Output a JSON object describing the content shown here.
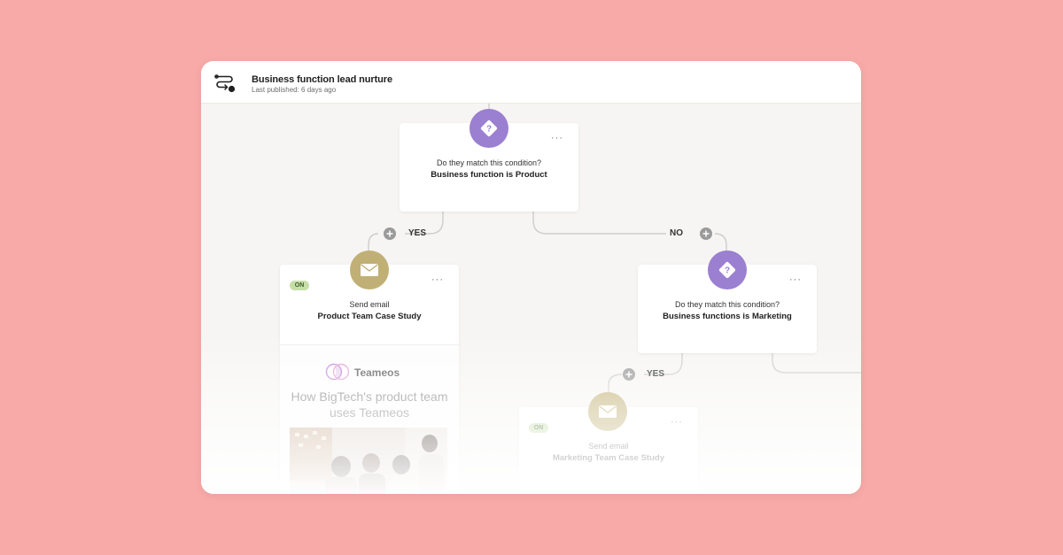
{
  "header": {
    "title": "Business function lead nurture",
    "subtitle": "Last published: 6 days ago",
    "icon": "workflow-icon"
  },
  "nodes": {
    "condition_product": {
      "type": "condition",
      "icon": "question-diamond-icon",
      "prompt": "Do they match this condition?",
      "condition": "Business function is Product",
      "menu": "···"
    },
    "email_product": {
      "type": "email",
      "icon": "envelope-icon",
      "status": "ON",
      "action": "Send email",
      "name": "Product Team Case Study",
      "menu": "···",
      "preview": {
        "brand": "Teameos",
        "heading": "How BigTech's product team uses Teameos"
      }
    },
    "condition_marketing": {
      "type": "condition",
      "icon": "question-diamond-icon",
      "prompt": "Do they match this condition?",
      "condition": "Business functions is Marketing",
      "menu": "···"
    },
    "email_marketing": {
      "type": "email",
      "icon": "envelope-icon",
      "status": "ON",
      "action": "Send email",
      "name": "Marketing Team Case Study",
      "menu": "···"
    }
  },
  "branches": {
    "yes_1": "YES",
    "no_1": "NO",
    "yes_2": "YES"
  },
  "colors": {
    "background": "#f7aaa8",
    "canvas": "#f6f5f3",
    "condition_node": "#9b7fd1",
    "email_node": "#c1b075",
    "on_badge": "#c6dfa9",
    "connector": "#cfcfcf"
  }
}
